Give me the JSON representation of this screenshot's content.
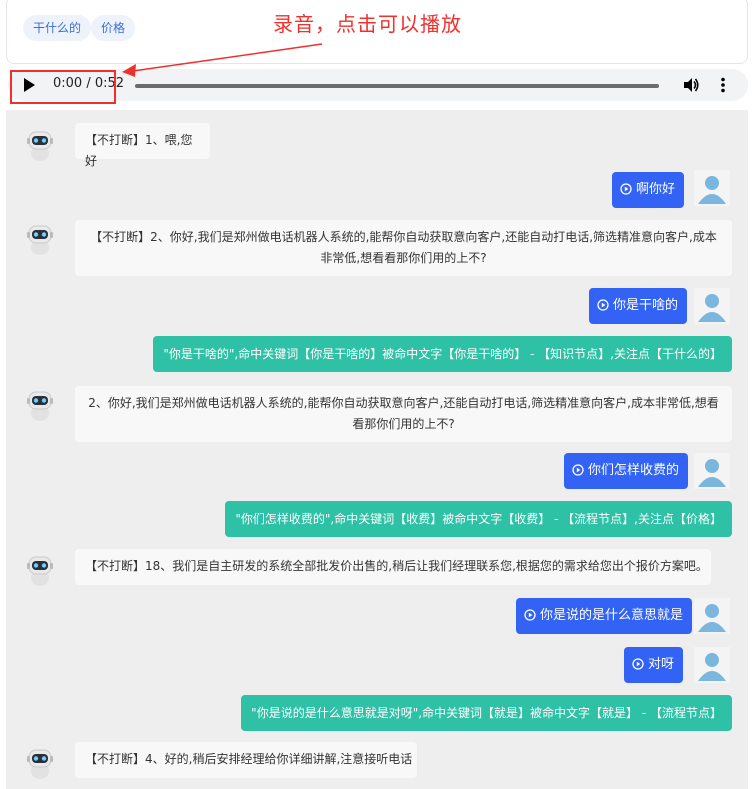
{
  "tags": [
    "干什么的",
    "价格"
  ],
  "annotation": "录音，点击可以播放",
  "player": {
    "time": "0:00 / 0:52"
  },
  "messages": {
    "m1": "【不打断】1、喂,您好",
    "u1": "啊你好",
    "m2": "【不打断】2、你好,我们是郑州做电话机器人系统的,能帮你自动获取意向客户,还能自动打电话,筛选精准意向客户,成本非常低,想看看那你们用的上不?",
    "u2": "你是干啥的",
    "h1": "\"你是干啥的\",命中关键词【你是干啥的】被命中文字【你是干啥的】 - 【知识节点】,关注点【干什么的】",
    "m3": "2、你好,我们是郑州做电话机器人系统的,能帮你自动获取意向客户,还能自动打电话,筛选精准意向客户,成本非常低,想看看那你们用的上不?",
    "u3": "你们怎样收费的",
    "h2": "\"你们怎样收费的\",命中关键词【收费】被命中文字【收费】 - 【流程节点】,关注点【价格】",
    "m4": "【不打断】18、我们是自主研发的系统全部批发价出售的,稍后让我们经理联系您,根据您的需求给您出个报价方案吧。",
    "u4": "你是说的是什么意思就是",
    "u5": "对呀",
    "h3": "\"你是说的是什么意思就是对呀\",命中关键词【就是】被命中文字【就是】 - 【流程节点】",
    "m5": "【不打断】4、好的,稍后安排经理给你详细讲解,注意接听电话"
  },
  "colors": {
    "user_bubble": "#3263f5",
    "hit_bubble": "#2ec1a6",
    "annotation": "#f0302d",
    "tag_text": "#3b6fd8"
  }
}
